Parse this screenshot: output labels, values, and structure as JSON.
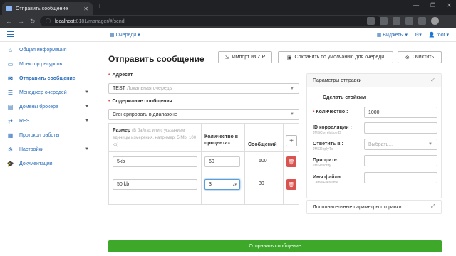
{
  "browser": {
    "tab_title": "Отправить сообщение",
    "url_host": "localhost",
    "url_rest": ":8181/manager/#/send"
  },
  "topbar": {
    "queues": "Очереди",
    "widgets": "Виджеты",
    "user": "root"
  },
  "sidebar": {
    "items": [
      {
        "label": "Общая информация",
        "icon": "home-icon"
      },
      {
        "label": "Монитор ресурсов",
        "icon": "monitor-icon"
      },
      {
        "label": "Отправить сообщение",
        "icon": "envelope-icon",
        "active": true
      },
      {
        "label": "Менеджер очередей",
        "icon": "queue-icon"
      },
      {
        "label": "Домены брокера",
        "icon": "folder-icon"
      },
      {
        "label": "REST",
        "icon": "exchange-icon"
      },
      {
        "label": "Протокол работы",
        "icon": "log-icon"
      },
      {
        "label": "Настройки",
        "icon": "gear-icon"
      },
      {
        "label": "Документация",
        "icon": "docs-icon"
      }
    ]
  },
  "main": {
    "title": "Отправить сообщение",
    "import_label": "Импорт из ZIP",
    "save_default_label": "Сохранить по умолчанию для очереди",
    "clear_label": "Очистить",
    "addressee_label": "Адресат",
    "addressee_value": "TEST",
    "addressee_hint": "Локальная очередь",
    "content_label": "Содержание сообщения",
    "content_value": "Сгенерировать в диапазоне",
    "table": {
      "col_size": "Размер",
      "col_size_hint": "(В байтах или с указанием единицы измерения, например: 5 Mb, 100 kb)",
      "col_count": "Количество в процентах",
      "col_msgs": "Сообщений",
      "rows": [
        {
          "size": "5kb",
          "percent": "60",
          "messages": "600"
        },
        {
          "size": "50 kb",
          "percent": "3",
          "messages": "30"
        }
      ]
    },
    "send_label": "Отправить сообщение"
  },
  "params": {
    "title": "Параметры отправки",
    "persistent_label": "Сделать стойким",
    "count_label": "Количество :",
    "count_value": "1000",
    "corr_label": "ID корреляции :",
    "corr_sub": "JMSCorrelationID",
    "reply_label": "Ответить в :",
    "reply_sub": "JMSReplyTo",
    "reply_placeholder": "Выбрать...",
    "priority_label": "Приоритет :",
    "priority_sub": "JMSPriority",
    "filename_label": "Имя файла :",
    "filename_sub": "CamelFileName",
    "additional": "Дополнительные параметры отправки"
  }
}
